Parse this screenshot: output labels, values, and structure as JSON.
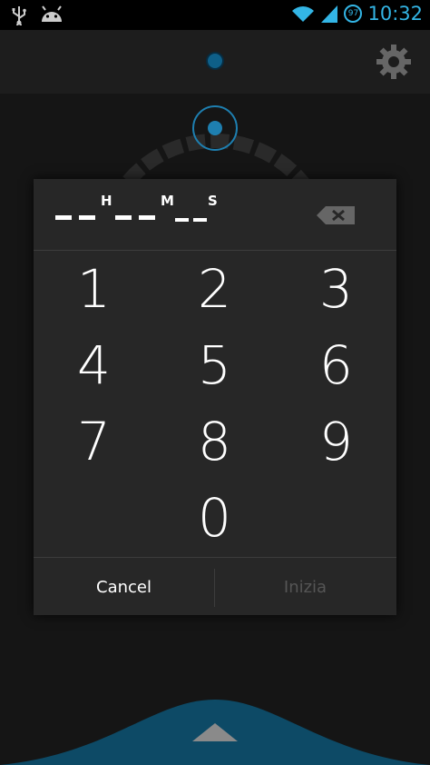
{
  "status_bar": {
    "time": "10:32",
    "battery_level": "97",
    "left_icons": [
      "usb-icon",
      "android-debug-icon"
    ],
    "right_icons": [
      "wifi-icon",
      "signal-icon",
      "battery-icon"
    ],
    "accent_color": "#33b5e5"
  },
  "app": {
    "settings_icon": "gear-icon"
  },
  "dialog": {
    "display": {
      "hours_value": "--",
      "hours_unit": "H",
      "minutes_value": "--",
      "minutes_unit": "M",
      "seconds_value": "--",
      "seconds_unit": "S"
    },
    "backspace_icon": "backspace-icon",
    "keys": [
      "1",
      "2",
      "3",
      "4",
      "5",
      "6",
      "7",
      "8",
      "9",
      "0"
    ],
    "cancel_label": "Cancel",
    "start_label": "Inizia",
    "start_color": "#555555"
  }
}
